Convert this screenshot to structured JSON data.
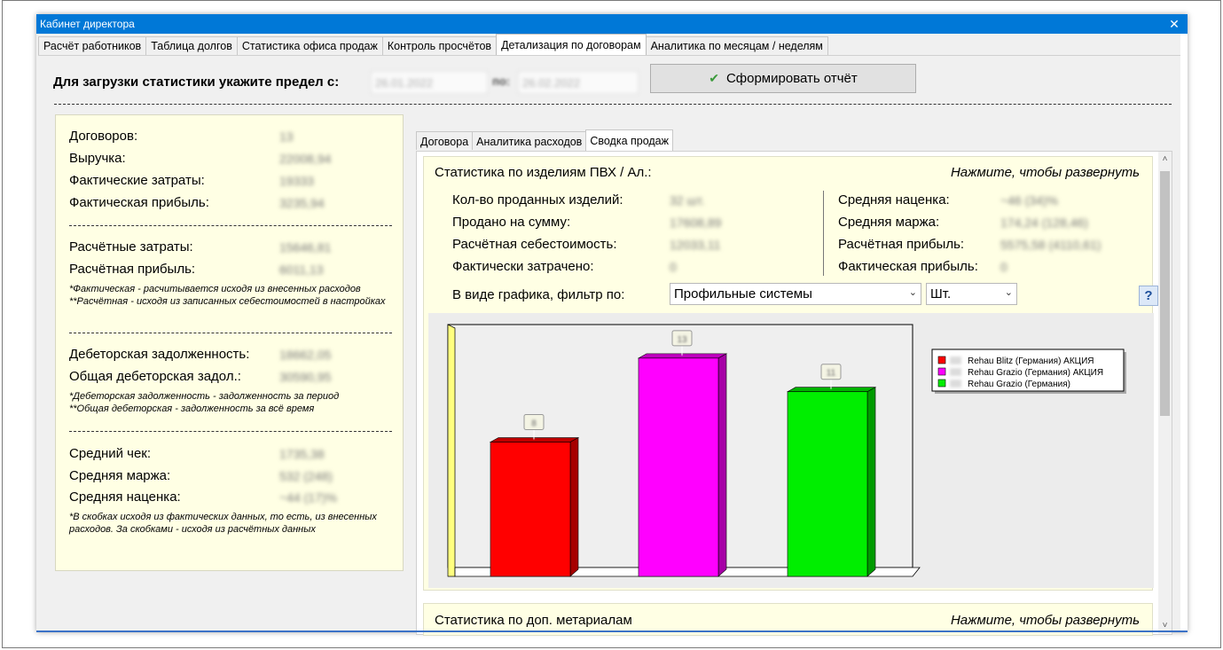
{
  "window": {
    "title": "Кабинет директора",
    "close_glyph": "✕"
  },
  "tabs": [
    {
      "label": "Расчёт работников",
      "active": false
    },
    {
      "label": "Таблица долгов",
      "active": false
    },
    {
      "label": "Статистика офиса продаж",
      "active": false
    },
    {
      "label": "Контроль просчётов",
      "active": false
    },
    {
      "label": "Детализация по договорам",
      "active": true
    },
    {
      "label": "Аналитика по месяцам / неделям",
      "active": false
    }
  ],
  "load": {
    "label": "Для загрузки статистики укажите предел с:",
    "date_from": "26.01.2022",
    "to_label": "по:",
    "date_to": "26.02.2022",
    "report_button": "Сформировать отчёт",
    "check_glyph": "✔"
  },
  "summary": {
    "contracts_label": "Договоров:",
    "contracts_value": "13",
    "revenue_label": "Выручка:",
    "revenue_value": "22008,94",
    "fact_costs_label": "Фактические затраты:",
    "fact_costs_value": "19333",
    "fact_profit_label": "Фактическая прибыль:",
    "fact_profit_value": "3235,94",
    "calc_costs_label": "Расчётные затраты:",
    "calc_costs_value": "15646,81",
    "calc_profit_label": "Расчётная прибыль:",
    "calc_profit_value": "6011,13",
    "note1_line1": "*Фактическая - расчитывается исходя из внесенных расходов",
    "note1_line2": "**Расчётная - исходя из записанных себестоимостей в настройках",
    "debt_label": "Дебеторская задолженность:",
    "debt_value": "18662,05",
    "total_debt_label": "Общая дебеторская задол.:",
    "total_debt_value": "30590,95",
    "note2_line1": "*Дебеторская задолженность - задолженность за период",
    "note2_line2": "**Общая дебеторская - задолженность за всё время",
    "avg_check_label": "Средний чек:",
    "avg_check_value": "1735,38",
    "avg_margin_label": "Средняя маржа:",
    "avg_margin_value": "532 (248)",
    "avg_markup_label": "Средняя наценка:",
    "avg_markup_value": "~44 (17)%",
    "note3": "*В скобках исходя из фактических данных, то есть, из внесенных расходов. За скобками - исходя из расчётных данных"
  },
  "sub_tabs": [
    {
      "label": "Договора",
      "active": false
    },
    {
      "label": "Аналитика расходов",
      "active": false
    },
    {
      "label": "Сводка продаж",
      "active": true
    }
  ],
  "pvc_panel": {
    "title": "Статистика по изделиям ПВХ / Ал.:",
    "expand": "Нажмите, чтобы развернуть",
    "sold_count_label": "Кол-во проданных изделий:",
    "sold_count_value": "32 шт.",
    "sold_sum_label": "Продано на сумму:",
    "sold_sum_value": "17608,89",
    "calc_cost_label": "Расчётная себестоимость:",
    "calc_cost_value": "12033,11",
    "actual_spent_label": "Фактически затрачено:",
    "actual_spent_value": "0",
    "avg_markup_label": "Средняя наценка:",
    "avg_markup_value": "~46 (34)%",
    "avg_margin_label": "Средняя маржа:",
    "avg_margin_value": "174,24 (128,46)",
    "calc_profit_label": "Расчётная прибыль:",
    "calc_profit_value": "5575,58 (4110,61)",
    "fact_profit_label": "Фактическая прибыль:",
    "fact_profit_value": "0",
    "filter_label": "В виде графика, фильтр по:",
    "filter_select": "Профильные системы",
    "unit_select": "Шт.",
    "help": "?"
  },
  "extra_panel": {
    "title": "Статистика по доп. метариалам",
    "expand": "Нажмите, чтобы развернуть"
  },
  "scroll": {
    "up": "˄",
    "down": "˅"
  },
  "chart_data": {
    "type": "bar",
    "categories": [
      "Rehau Blitz (Германия) АКЦИЯ",
      "Rehau Grazio (Германия) АКЦИЯ",
      "Rehau Grazio (Германия)"
    ],
    "values": [
      8,
      13,
      11
    ],
    "data_labels": [
      "8",
      "13",
      "11"
    ],
    "colors": [
      "#ff0000",
      "#ff00ff",
      "#00ee00"
    ],
    "legend": [
      "Rehau Blitz (Германия) АКЦИЯ",
      "Rehau Grazio (Германия) АКЦИЯ",
      "Rehau Grazio (Германия)"
    ],
    "legend_placement": "top-right",
    "ylim": [
      0,
      15
    ],
    "grid": false
  }
}
